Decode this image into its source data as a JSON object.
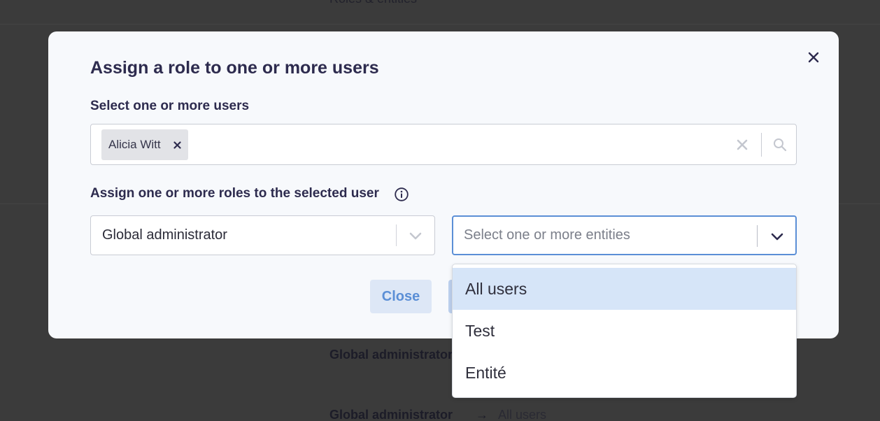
{
  "background": {
    "header_text": "Roles & entities",
    "row1": {
      "role": "Global administrator"
    },
    "row2": {
      "role": "Global administrator",
      "arrow": "→",
      "entity": "All users"
    }
  },
  "modal": {
    "title": "Assign a role to one or more users",
    "close_icon": "close-icon",
    "users_section": {
      "label": "Select one or more users",
      "selected": [
        {
          "name": "Alicia Witt"
        }
      ],
      "clear_icon": "clear-icon",
      "search_icon": "search-icon"
    },
    "roles_section": {
      "label": "Assign one or more roles to the selected user",
      "info_icon": "info-icon",
      "role_select": {
        "value": "Global administrator"
      },
      "entity_select": {
        "placeholder": "Select one or more entities"
      }
    },
    "buttons": {
      "close_label": "Close"
    }
  },
  "dropdown": {
    "options": [
      {
        "label": "All users",
        "highlighted": true
      },
      {
        "label": "Test",
        "highlighted": false
      },
      {
        "label": "Entité",
        "highlighted": false
      }
    ]
  },
  "colors": {
    "accent": "#5b8fd6",
    "title": "#2d2b4e",
    "highlight": "#d6e5f8"
  }
}
